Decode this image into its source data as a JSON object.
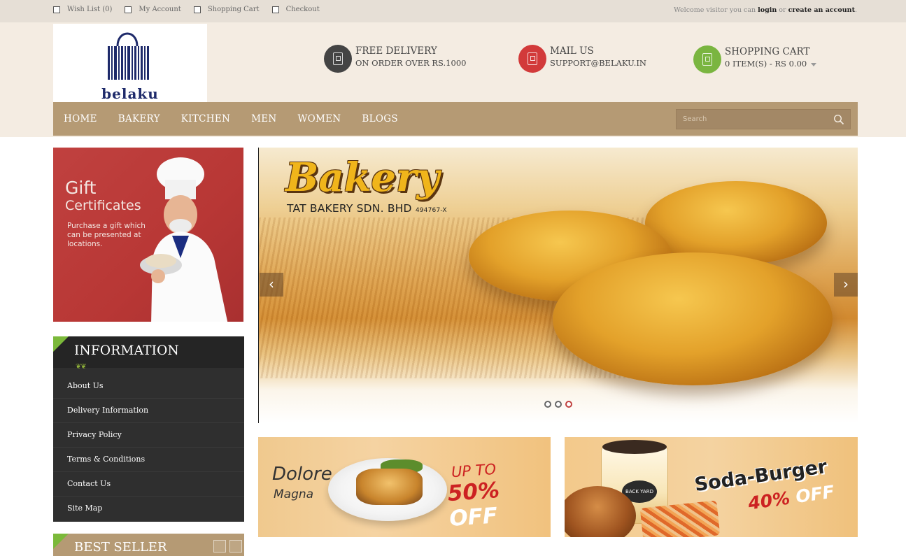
{
  "topbar": {
    "links": [
      {
        "label": "Wish List (0)"
      },
      {
        "label": "My Account"
      },
      {
        "label": "Shopping Cart"
      },
      {
        "label": "Checkout"
      }
    ],
    "welcome_prefix": "Welcome visitor you can ",
    "login": "login",
    "or": " or ",
    "create_account": "create an account",
    "period": "."
  },
  "logo": {
    "text": "belaku"
  },
  "features": {
    "delivery": {
      "title": "FREE DELIVERY",
      "sub": "ON ORDER OVER RS.1000",
      "color": "#444444"
    },
    "mail": {
      "title": "MAIL US",
      "sub": "SUPPORT@BELAKU.IN",
      "color": "#d23a3a"
    },
    "cart": {
      "title": "SHOPPING CART",
      "sub": "0 ITEM(S) - RS 0.00",
      "color": "#7ab540"
    }
  },
  "nav": {
    "items": [
      {
        "label": "HOME"
      },
      {
        "label": "BAKERY"
      },
      {
        "label": "KITCHEN"
      },
      {
        "label": "MEN"
      },
      {
        "label": "WOMEN"
      },
      {
        "label": "BLOGS"
      }
    ],
    "search_placeholder": "Search"
  },
  "gift": {
    "title": "Gift",
    "subtitle": "Certificates",
    "description": "Purchase a gift which can be presented at locations."
  },
  "information": {
    "title": "INFORMATION",
    "items": [
      {
        "label": "About Us"
      },
      {
        "label": "Delivery Information"
      },
      {
        "label": "Privacy Policy"
      },
      {
        "label": "Terms & Conditions"
      },
      {
        "label": "Contact Us"
      },
      {
        "label": "Site Map"
      }
    ]
  },
  "best_seller": {
    "title": "BEST SELLER"
  },
  "slider": {
    "brand": "Bakery",
    "company": "TAT BAKERY SDN. BHD",
    "company_no": "494767-X",
    "prev": "‹",
    "next": "›",
    "active_slide": 3,
    "total_slides": 3
  },
  "banners": {
    "left": {
      "title": "Dolore",
      "subtitle": "Magna",
      "upto": "UP TO",
      "percent": "50%",
      "off": "OFF"
    },
    "right": {
      "title": "Soda-Burger",
      "percent": "40%",
      "off": "OFF",
      "cup_logo": "BACK YARD"
    }
  },
  "colors": {
    "nav_bg": "#b59a74",
    "header_bg": "#f4ece2",
    "topbar_bg": "#e6dfd6",
    "accent_green": "#7bb93a",
    "accent_red": "#c0413f"
  }
}
